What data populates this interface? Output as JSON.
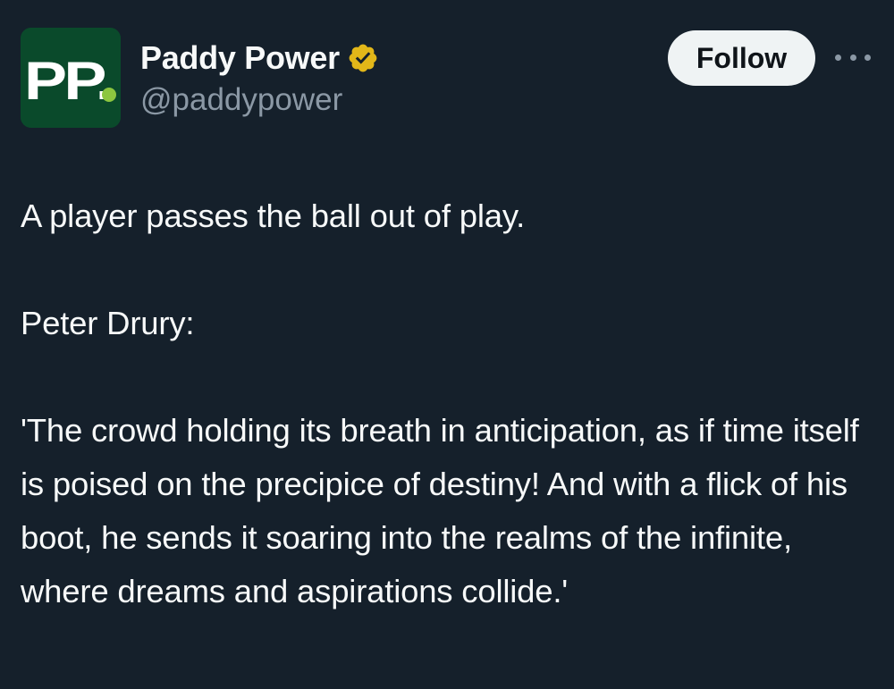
{
  "account": {
    "display_name": "Paddy Power",
    "handle": "@paddypower",
    "avatar_text": "PP.",
    "verified_icon": "verified-badge-gold"
  },
  "actions": {
    "follow_label": "Follow",
    "more_icon": "more-horizontal-icon"
  },
  "tweet": {
    "paragraphs": [
      "A player passes the ball out of play.",
      "Peter Drury:",
      "'The crowd holding its breath in anticipation, as if time itself is poised on the precipice of destiny! And with a flick of his boot, he sends it soaring into the realms of the infinite, where dreams and aspirations collide.'"
    ]
  },
  "colors": {
    "background": "#15202b",
    "text": "#f7f9f9",
    "secondary_text": "#8b98a5",
    "brand_green": "#0a4a2b",
    "brand_dot": "#8cc63f",
    "verified_gold": "#e2b719",
    "follow_bg": "#eff3f4"
  }
}
